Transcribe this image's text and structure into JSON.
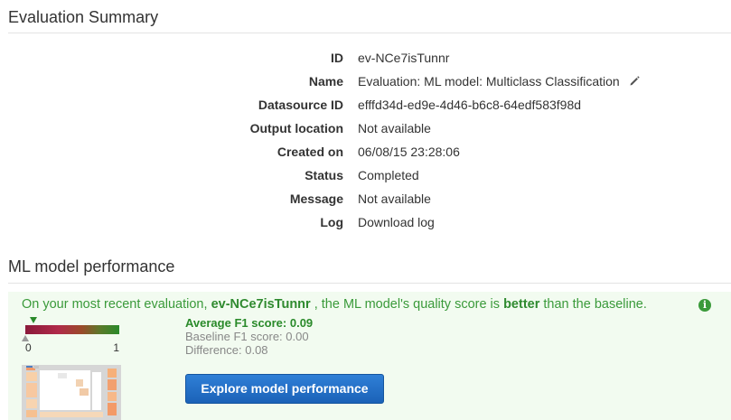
{
  "summary": {
    "title": "Evaluation Summary",
    "fields": {
      "id": {
        "label": "ID",
        "value": "ev-NCe7isTunnr"
      },
      "name": {
        "label": "Name",
        "value": "Evaluation: ML model: Multiclass Classification",
        "icon": "pencil-icon"
      },
      "datasource": {
        "label": "Datasource ID",
        "value": "efffd34d-ed9e-4d46-b6c8-64edf583f98d"
      },
      "output": {
        "label": "Output location",
        "value": "Not available"
      },
      "created": {
        "label": "Created on",
        "value": "06/08/15 23:28:06"
      },
      "status": {
        "label": "Status",
        "value": "Completed",
        "color": "#2a8a2a"
      },
      "message": {
        "label": "Message",
        "value": "Not available"
      },
      "log": {
        "label": "Log",
        "value": "Download log"
      }
    }
  },
  "performance": {
    "title": "ML model performance",
    "headline": {
      "prefix": "On your most recent evaluation, ",
      "eval_id": "ev-NCe7isTunnr",
      "middle": " , the ML model's quality score is ",
      "verdict": "better",
      "suffix": " than the baseline."
    },
    "scale": {
      "min_label": "0",
      "max_label": "1",
      "model_score": 0.09,
      "baseline_score": 0.0
    },
    "avg_f1": "Average F1 score: 0.09",
    "baseline_f1": "Baseline F1 score: 0.00",
    "difference": "Difference: 0.08",
    "explore_button": "Explore model performance",
    "colors": {
      "accent": "#2a8a2a",
      "button": "#1b62b8",
      "panel_bg": "#f2fbf0"
    }
  }
}
